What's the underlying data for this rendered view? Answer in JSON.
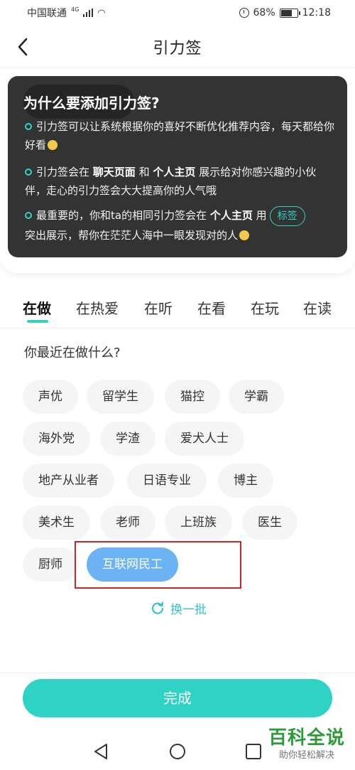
{
  "status_bar": {
    "carrier": "中国联通",
    "network": "4G",
    "battery": "68%",
    "time": "12:18"
  },
  "header": {
    "title": "引力签"
  },
  "info_card": {
    "title": "为什么要添加引力签?",
    "p1": "引力签可以让系统根据你的喜好不断优化推荐内容，每天都给你好看",
    "p2_a": "引力签会在",
    "p2_b1": "聊天页面",
    "p2_c": "和",
    "p2_b2": "个人主页",
    "p2_d": "展示给对你感兴趣的小伙伴，走心的引力签会大大提高你的人气哦",
    "p3_a": "最重要的，你和ta的相同引力签会在",
    "p3_b": "个人主页",
    "p3_c": "用",
    "p3_tag": "标签",
    "p3_d": "突出展示，帮你在茫茫人海中一眼发现对的人"
  },
  "tabs": [
    "在做",
    "在热爱",
    "在听",
    "在看",
    "在玩",
    "在读"
  ],
  "active_tab": 0,
  "question": "你最近在做什么?",
  "tags": [
    "声优",
    "留学生",
    "猫控",
    "学霸",
    "海外党",
    "学渣",
    "爱犬人士",
    "地产从业者",
    "日语专业",
    "博主",
    "美术生",
    "老师",
    "上班族",
    "医生",
    "厨师",
    "互联网民工"
  ],
  "selected_tag": "互联网民工",
  "refresh_label": "换一批",
  "done_label": "完成",
  "watermark": {
    "main": "百科全说",
    "sub": "助你轻松解决"
  },
  "colors": {
    "accent": "#2ed3c6",
    "selected_tag": "#6cb3f3",
    "card_bg": "#333333",
    "highlight_box": "#c62828"
  }
}
